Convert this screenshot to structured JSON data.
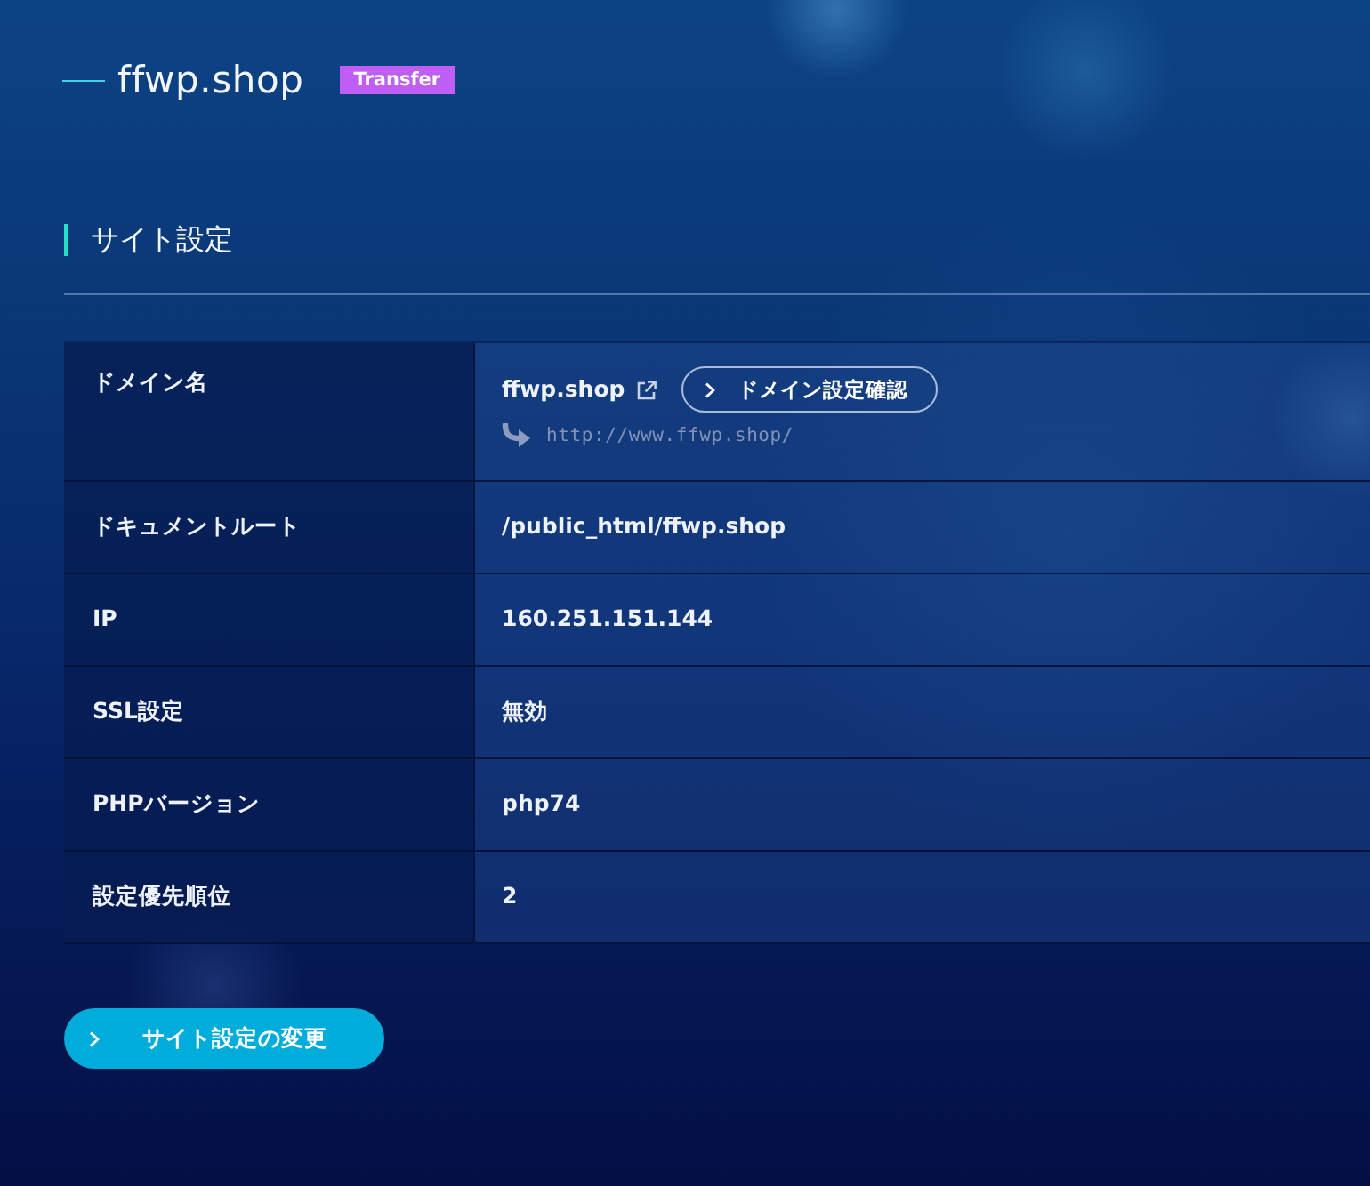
{
  "site": {
    "title": "ffwp.shop",
    "badge": "Transfer"
  },
  "section": {
    "title": "サイト設定"
  },
  "table": {
    "rows": [
      {
        "kind": "domain",
        "label": "ドメイン名",
        "value": "ffwp.shop",
        "button": "ドメイン設定確認",
        "redirect": "http://www.ffwp.shop/"
      },
      {
        "kind": "text",
        "label": "ドキュメントルート",
        "value": "/public_html/ffwp.shop"
      },
      {
        "kind": "text",
        "label": "IP",
        "value": "160.251.151.144"
      },
      {
        "kind": "text",
        "label": "SSL設定",
        "value": "無効"
      },
      {
        "kind": "text",
        "label": "PHPバージョン",
        "value": "php74"
      },
      {
        "kind": "text",
        "label": "設定優先順位",
        "value": "2"
      }
    ]
  },
  "buttons": [
    {
      "label": "サイト設定の変更"
    }
  ]
}
